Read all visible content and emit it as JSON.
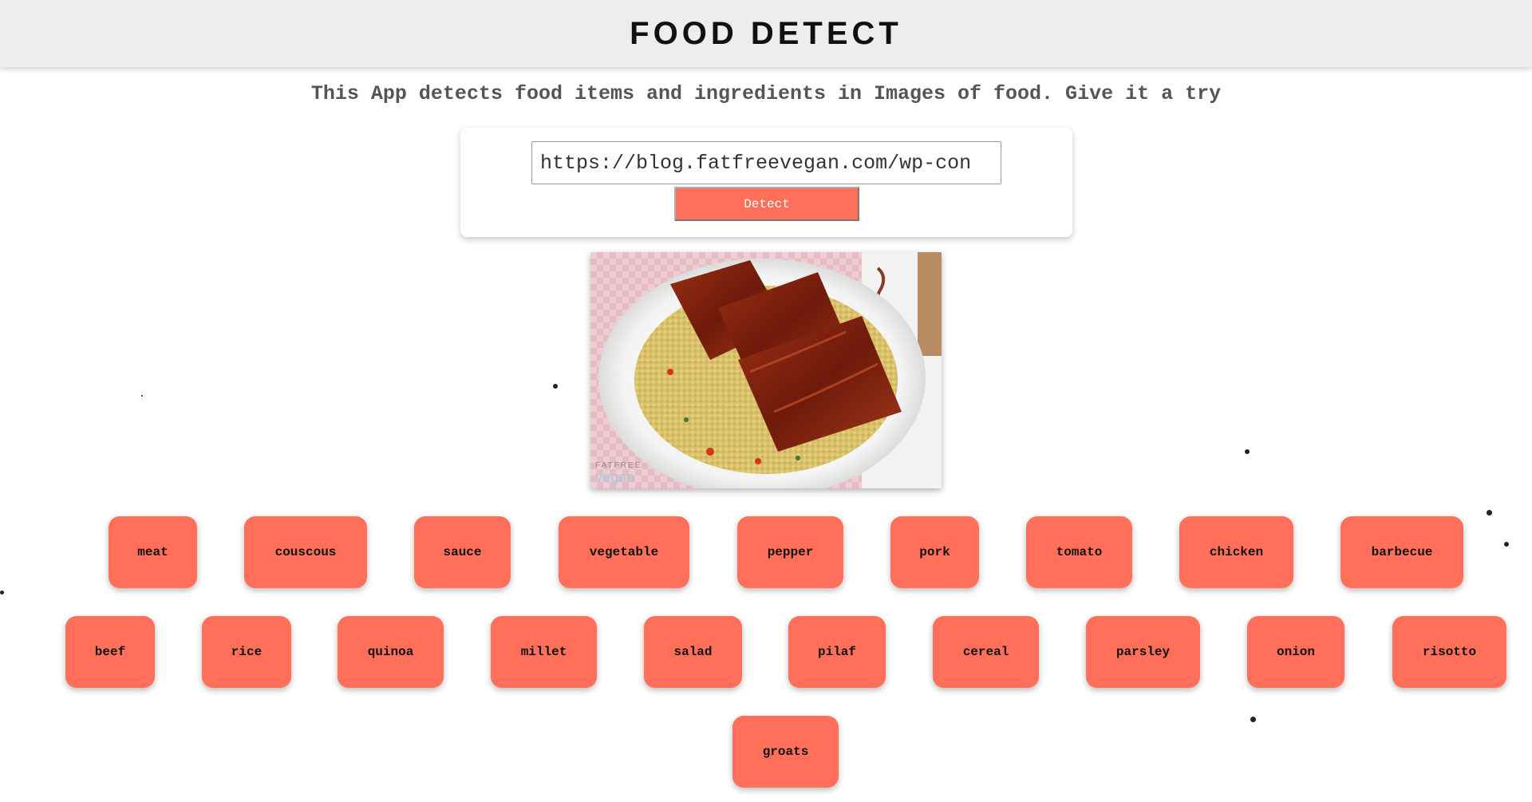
{
  "header": {
    "title": "FOOD DETECT"
  },
  "tagline": "This App detects food items and ingredients in Images of food. Give it a try",
  "form": {
    "url_value": "https://blog.fatfreevegan.com/wp-con",
    "detect_label": "Detect"
  },
  "photo": {
    "watermark_top": "FATFREE",
    "watermark_bottom": "vegan"
  },
  "colors": {
    "accent": "#ff6f5a",
    "header_bg": "#ededed"
  },
  "tags": {
    "row1": [
      "meat",
      "couscous",
      "sauce",
      "vegetable",
      "pepper",
      "pork",
      "tomato",
      "chicken",
      "barbecue"
    ],
    "row2": [
      "beef",
      "rice",
      "quinoa",
      "millet",
      "salad",
      "pilaf",
      "cereal",
      "parsley",
      "onion",
      "risotto"
    ],
    "row3": [
      "groats"
    ]
  }
}
